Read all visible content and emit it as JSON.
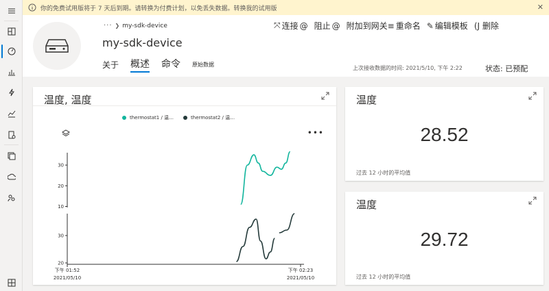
{
  "banner": {
    "text": "你的免费试用版将于 7 天后到期。请转换为付费计划，以免丢失数据。转换我的试用版"
  },
  "rail": {
    "items": [
      {
        "icon": "hamburger-menu-icon"
      },
      {
        "icon": "dashboard-icon"
      },
      {
        "icon": "devices-icon"
      },
      {
        "icon": "device-groups-icon"
      },
      {
        "icon": "rules-icon"
      },
      {
        "icon": "analytics-icon"
      },
      {
        "icon": "jobs-icon"
      },
      {
        "icon": "device-templates-icon"
      },
      {
        "icon": "data-export-icon"
      },
      {
        "icon": "administration-icon"
      },
      {
        "icon": "settings-icon"
      }
    ]
  },
  "header": {
    "breadcrumb_parent": "···",
    "breadcrumb_current": "my-sdk-device",
    "title": "my-sdk-device",
    "toolbar": [
      {
        "icon": "connect-icon",
        "label": "连接"
      },
      {
        "icon": "at-icon",
        "label": "@"
      },
      {
        "label": "阻止"
      },
      {
        "icon": "at-icon",
        "label": "@"
      },
      {
        "label": "附加到网关"
      },
      {
        "icon": "rename-icon",
        "label": "重命名"
      },
      {
        "icon": "edit-template-icon",
        "label": "编辑模板"
      },
      {
        "label": "(J 删除"
      }
    ],
    "tabs": [
      {
        "label": "关于",
        "style": "normal",
        "active": false
      },
      {
        "label": "概述",
        "style": "big",
        "active": true
      },
      {
        "label": "命令",
        "style": "big",
        "active": false
      },
      {
        "label": "原始数据",
        "style": "small",
        "active": false
      }
    ],
    "last_received": "上次接收数据的时间: 2021/5/10, 下午 2:22",
    "status": "状态: 已预配"
  },
  "tiles": {
    "chart_tile": {
      "title": "温度, 温度"
    },
    "kpi1": {
      "title": "温度",
      "value": "28.52",
      "caption": "过去 12 小时的平均值"
    },
    "kpi2": {
      "title": "温度",
      "value": "29.72",
      "caption": "过去 12 小时的平均值"
    }
  },
  "colors": {
    "series1": "#12b59d",
    "series2": "#243a3a",
    "accent": "#0078d4"
  },
  "chart_data": {
    "type": "line",
    "legend_placement": "top",
    "series": [
      {
        "name": "thermostat1 / 温…",
        "y_ticks": [
          10,
          20,
          30
        ],
        "ylim": [
          9.5,
          36
        ],
        "points": [
          [
            0.79,
            11
          ],
          [
            0.82,
            30
          ],
          [
            0.85,
            35
          ],
          [
            0.87,
            31
          ],
          [
            0.89,
            27
          ],
          [
            0.925,
            25
          ],
          [
            0.955,
            29
          ],
          [
            0.975,
            28
          ],
          [
            0.995,
            31
          ],
          [
            1.015,
            36.5
          ]
        ],
        "values_min": 11,
        "values_max": 36.5
      },
      {
        "name": "thermostat2 / 温…",
        "y_ticks": [
          20,
          30
        ],
        "ylim": [
          19.5,
          38
        ],
        "points": [
          [
            0.77,
            20.5
          ],
          [
            0.8,
            26
          ],
          [
            0.83,
            33
          ],
          [
            0.86,
            36
          ],
          [
            0.88,
            28
          ],
          [
            0.905,
            21.5
          ],
          [
            0.925,
            24
          ],
          [
            0.945,
            29
          ],
          [
            0.965,
            31
          ],
          [
            1.0,
            32
          ],
          [
            1.035,
            38
          ]
        ],
        "gap_after_index": 7
      }
    ],
    "x_ticks": [
      {
        "line1": "下午 01:52",
        "line2": "2021/05/10"
      },
      {
        "line1": "下午 02:23",
        "line2": "2021/05/10"
      }
    ]
  }
}
